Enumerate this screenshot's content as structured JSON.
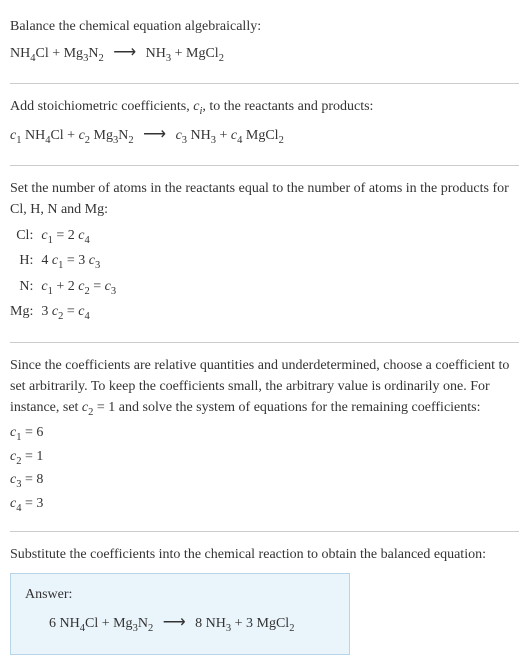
{
  "section1": {
    "title": "Balance the chemical equation algebraically:",
    "eq_lhs1": "NH",
    "eq_lhs1_sub": "4",
    "eq_lhs2": "Cl + Mg",
    "eq_lhs2_sub": "3",
    "eq_lhs3": "N",
    "eq_lhs3_sub": "2",
    "arrow": "⟶",
    "eq_rhs1": "NH",
    "eq_rhs1_sub": "3",
    "eq_rhs2": " + MgCl",
    "eq_rhs2_sub": "2"
  },
  "section2": {
    "text_a": "Add stoichiometric coefficients, ",
    "ci": "c",
    "ci_sub": "i",
    "text_b": ", to the reactants and products:",
    "c1": "c",
    "c1_sub": "1",
    "sp1": " NH",
    "sp1_sub": "4",
    "sp1b": "Cl + ",
    "c2": "c",
    "c2_sub": "2",
    "sp2": " Mg",
    "sp2_sub": "3",
    "sp2b": "N",
    "sp2b_sub": "2",
    "arrow": "⟶",
    "c3": "c",
    "c3_sub": "3",
    "sp3": " NH",
    "sp3_sub": "3",
    "sp3b": " + ",
    "c4": "c",
    "c4_sub": "4",
    "sp4": " MgCl",
    "sp4_sub": "2"
  },
  "section3": {
    "text": "Set the number of atoms in the reactants equal to the number of atoms in the products for Cl, H, N and Mg:",
    "rows": [
      {
        "el": "Cl:",
        "lhs_c": "c",
        "lhs_sub": "1",
        "eq": " = 2 ",
        "rhs_c": "c",
        "rhs_sub": "4"
      },
      {
        "el": "H:",
        "pre": "4 ",
        "lhs_c": "c",
        "lhs_sub": "1",
        "eq": " = 3 ",
        "rhs_c": "c",
        "rhs_sub": "3"
      },
      {
        "el": "N:",
        "lhs_c": "c",
        "lhs_sub": "1",
        "mid": " + 2 ",
        "mid_c": "c",
        "mid_sub": "2",
        "eq": " = ",
        "rhs_c": "c",
        "rhs_sub": "3"
      },
      {
        "el": "Mg:",
        "pre": "3 ",
        "lhs_c": "c",
        "lhs_sub": "2",
        "eq": " = ",
        "rhs_c": "c",
        "rhs_sub": "4"
      }
    ]
  },
  "section4": {
    "text_a": "Since the coefficients are relative quantities and underdetermined, choose a coefficient to set arbitrarily. To keep the coefficients small, the arbitrary value is ordinarily one. For instance, set ",
    "c2": "c",
    "c2_sub": "2",
    "text_b": " = 1 and solve the system of equations for the remaining coefficients:",
    "lines": [
      {
        "c": "c",
        "sub": "1",
        "val": " = 6"
      },
      {
        "c": "c",
        "sub": "2",
        "val": " = 1"
      },
      {
        "c": "c",
        "sub": "3",
        "val": " = 8"
      },
      {
        "c": "c",
        "sub": "4",
        "val": " = 3"
      }
    ]
  },
  "section5": {
    "text": "Substitute the coefficients into the chemical reaction to obtain the balanced equation:"
  },
  "answer": {
    "label": "Answer:",
    "eq_a": "6 NH",
    "eq_a_sub": "4",
    "eq_b": "Cl + Mg",
    "eq_b_sub": "3",
    "eq_c": "N",
    "eq_c_sub": "2",
    "arrow": "⟶",
    "eq_d": "8 NH",
    "eq_d_sub": "3",
    "eq_e": " + 3 MgCl",
    "eq_e_sub": "2"
  }
}
